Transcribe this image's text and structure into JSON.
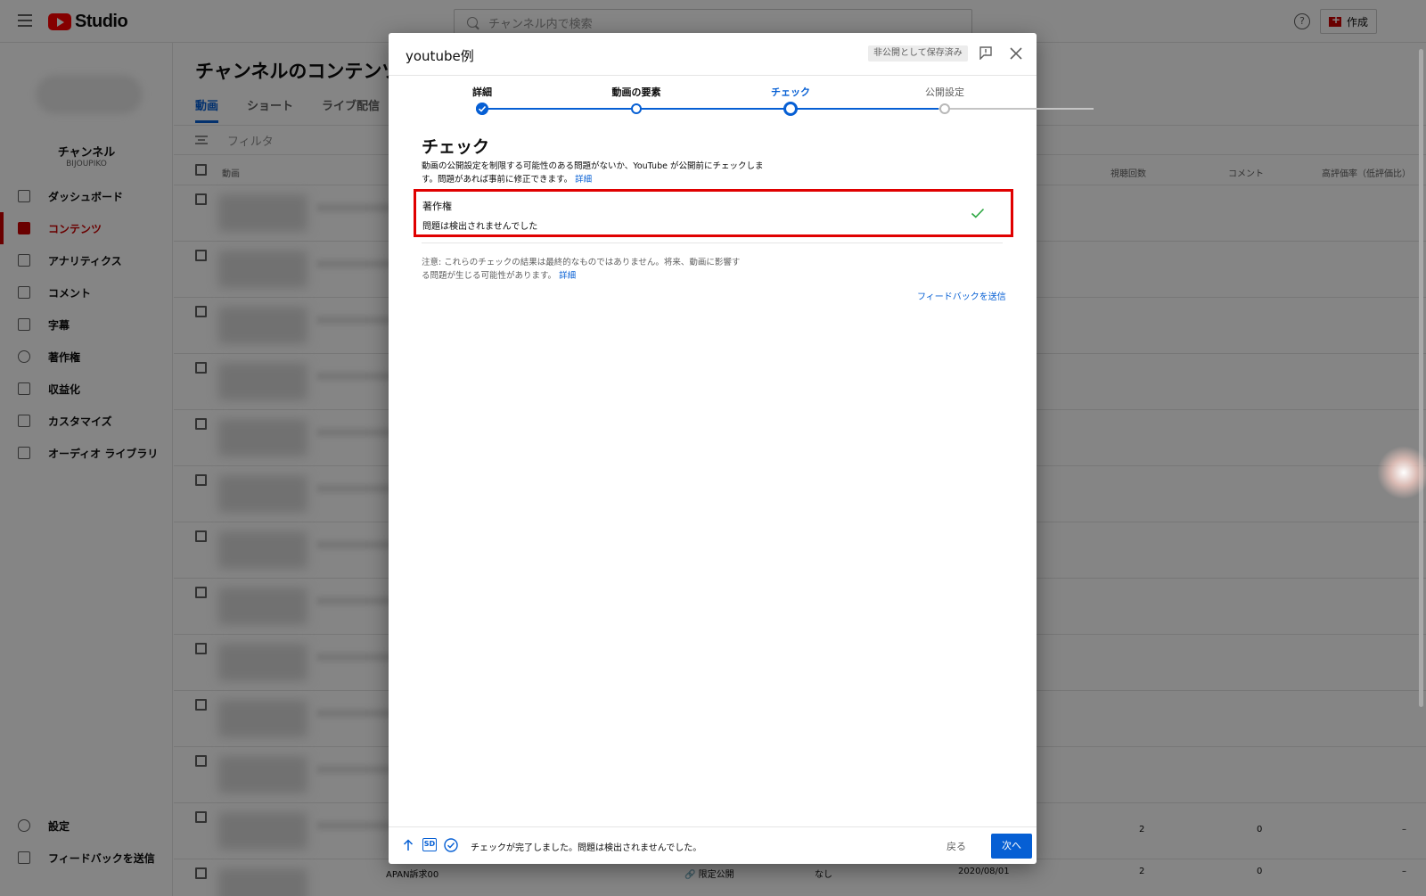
{
  "app": {
    "logo_text": "Studio",
    "search_placeholder": "チャンネル内で検索",
    "create_label": "作成",
    "help_glyph": "?"
  },
  "sidebar": {
    "channel_name": "チャンネル",
    "channel_handle": "BIJOUPIKO",
    "items": [
      {
        "label": "ダッシュボード",
        "icon": "dashboard-icon"
      },
      {
        "label": "コンテンツ",
        "icon": "content-icon",
        "active": true
      },
      {
        "label": "アナリティクス",
        "icon": "analytics-icon"
      },
      {
        "label": "コメント",
        "icon": "comment-icon"
      },
      {
        "label": "字幕",
        "icon": "subtitles-icon"
      },
      {
        "label": "著作権",
        "icon": "copyright-icon"
      },
      {
        "label": "収益化",
        "icon": "dollar-icon"
      },
      {
        "label": "カスタマイズ",
        "icon": "magic-wand-icon"
      },
      {
        "label": "オーディオ ライブラリ",
        "icon": "audio-library-icon"
      }
    ],
    "bottom_items": [
      {
        "label": "設定",
        "icon": "gear-icon"
      },
      {
        "label": "フィードバックを送信",
        "icon": "feedback-icon"
      }
    ]
  },
  "main": {
    "title": "チャンネルのコンテンツ",
    "tabs": [
      "動画",
      "ショート",
      "ライブ配信"
    ],
    "filter_label": "フィルタ",
    "columns": {
      "video": "動画",
      "views": "視聴回数",
      "comments": "コメント",
      "likes": "高評価率（低評価比）"
    },
    "row_12": {
      "views": "2",
      "comments": "0",
      "likes": "–"
    },
    "row_13": {
      "title": "APAN訴求00",
      "visibility": "限定公開",
      "restriction": "なし",
      "date": "2020/08/01",
      "views": "2",
      "comments": "0",
      "likes": "–"
    }
  },
  "dialog": {
    "title": "youtube例",
    "saved_badge": "非公開として保存済み",
    "steps": [
      {
        "label": "詳細",
        "state": "done"
      },
      {
        "label": "動画の要素",
        "state": "done"
      },
      {
        "label": "チェック",
        "state": "current"
      },
      {
        "label": "公開設定",
        "state": "pending"
      }
    ],
    "section_title": "チェック",
    "description_line1": "動画の公開設定を制限する可能性のある問題がないか、YouTube が公開前にチェックしま",
    "description_line2": "す。問題があれば事前に修正できます。",
    "description_link": "詳細",
    "check": {
      "name": "著作権",
      "status": "問題は検出されませんでした"
    },
    "note_line1": "注意: これらのチェックの結果は最終的なものではありません。将来、動画に影響す",
    "note_line2": "る問題が生じる可能性があります。",
    "note_link": "詳細",
    "feedback": "フィードバックを送信",
    "footer": {
      "sd_label": "SD",
      "message": "チェックが完了しました。問題は検出されませんでした。",
      "back": "戻る",
      "next": "次へ"
    }
  },
  "colors": {
    "accent": "#065fd4",
    "brand": "#ff0000",
    "highlight_border": "#e00000",
    "success": "#2ba640"
  }
}
